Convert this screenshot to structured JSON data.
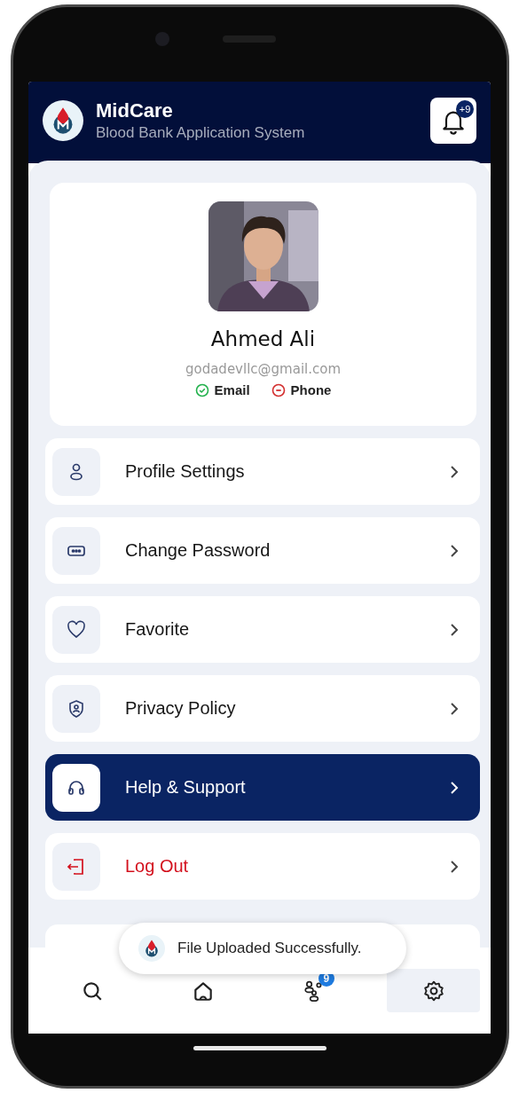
{
  "app": {
    "title": "MidCare",
    "subtitle": "Blood Bank Application System",
    "notification_badge": "+9"
  },
  "profile": {
    "name": "Ahmed Ali",
    "email": "godadevllc@gmail.com",
    "verifications": [
      {
        "label": "Email",
        "verified": true
      },
      {
        "label": "Phone",
        "verified": false
      }
    ]
  },
  "menu": [
    {
      "label": "Profile Settings",
      "kind": "normal",
      "selected": false
    },
    {
      "label": "Change Password",
      "kind": "normal",
      "selected": false
    },
    {
      "label": "Favorite",
      "kind": "normal",
      "selected": false
    },
    {
      "label": "Privacy Policy",
      "kind": "normal",
      "selected": false
    },
    {
      "label": "Help & Support",
      "kind": "normal",
      "selected": true
    },
    {
      "label": "Log Out",
      "kind": "danger",
      "selected": false
    }
  ],
  "toast": {
    "message": "File Uploaded Successfully."
  },
  "nav": [
    {
      "selected": false
    },
    {
      "selected": false
    },
    {
      "badge": "9",
      "selected": false
    },
    {
      "selected": true
    }
  ]
}
